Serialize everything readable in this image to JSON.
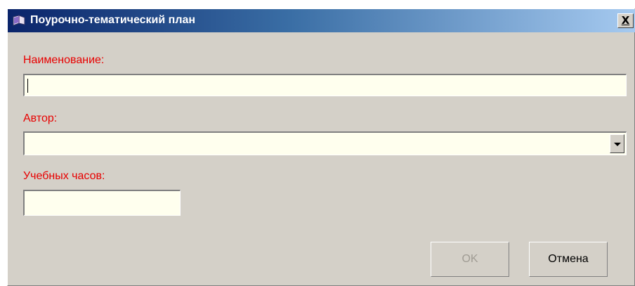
{
  "dialog": {
    "title": "Поурочно-тематический план",
    "close_label": "X"
  },
  "form": {
    "name_label": "Наименование:",
    "name_value": "",
    "author_label": "Автор:",
    "author_value": "",
    "hours_label": "Учебных часов:",
    "hours_value": ""
  },
  "buttons": {
    "ok_label": "OK",
    "cancel_label": "Отмена"
  },
  "colors": {
    "label_red": "#e80000",
    "field_bg": "#ffffee",
    "dialog_bg": "#d4d0c8",
    "titlebar_start": "#0a246a"
  },
  "icons": {
    "title": "book-icon",
    "combo": "chevron-down-icon"
  }
}
